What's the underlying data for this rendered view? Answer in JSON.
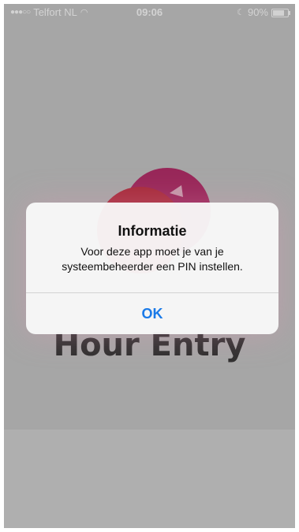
{
  "status_bar": {
    "carrier": "Telfort NL",
    "time": "09:06",
    "battery_percent": "90%",
    "battery_level": 0.9,
    "icons": [
      "signal-dots-icon",
      "wifi-icon",
      "do-not-disturb-icon",
      "battery-icon"
    ]
  },
  "app": {
    "title": "Hour Entry",
    "logo_colors": {
      "primary": "#b9283b",
      "secondary": "#a8245f"
    }
  },
  "alert": {
    "title": "Informatie",
    "message": "Voor deze app moet je van je systeembeheerder een PIN instellen.",
    "ok_label": "OK",
    "button_color": "#1a7ae8"
  }
}
